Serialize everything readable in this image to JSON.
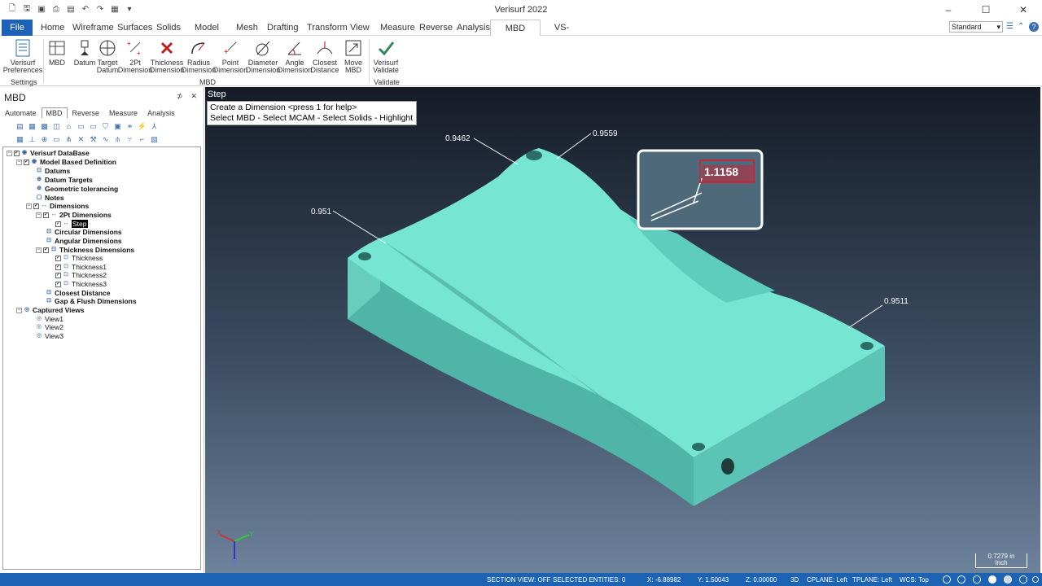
{
  "app": {
    "title": "Verisurf 2022"
  },
  "qat": {
    "more": "▾"
  },
  "tabs": [
    "File",
    "Home",
    "Wireframe",
    "Surfaces",
    "Solids",
    "Model Prep",
    "Mesh",
    "Drafting",
    "Transform",
    "View",
    "Measure",
    "Reverse",
    "Analysis",
    "MBD Validate",
    "VS-Tools"
  ],
  "active_tab": "MBD Validate",
  "style_select": "Standard",
  "ribbon": {
    "buttons": [
      {
        "l1": "Verisurf",
        "l2": "Preferences"
      },
      {
        "l1": "MBD",
        "l2": ""
      },
      {
        "l1": "Datum",
        "l2": ""
      },
      {
        "l1": "Target",
        "l2": "Datum"
      },
      {
        "l1": "2Pt",
        "l2": "Dimension"
      },
      {
        "l1": "Thickness",
        "l2": "Dimension"
      },
      {
        "l1": "Radius",
        "l2": "Dimension"
      },
      {
        "l1": "Point",
        "l2": "Dimension"
      },
      {
        "l1": "Diameter",
        "l2": "Dimension"
      },
      {
        "l1": "Angle",
        "l2": "Dimension"
      },
      {
        "l1": "Closest",
        "l2": "Distance"
      },
      {
        "l1": "Move",
        "l2": "MBD"
      },
      {
        "l1": "Verisurf",
        "l2": "Validate"
      }
    ],
    "groups": {
      "settings": "Settings",
      "mbd": "MBD",
      "validate": "Validate"
    }
  },
  "panel": {
    "title": "MBD",
    "pin": "⊅",
    "close": "✕",
    "tabs": [
      "Automate",
      "MBD",
      "Reverse",
      "Measure",
      "Analysis"
    ],
    "active_tab": "MBD",
    "tree": [
      "Verisurf DataBase",
      "Model Based Definition",
      "Datums",
      "Datum Targets",
      "Geometric tolerancing",
      "Notes",
      "Dimensions",
      "2Pt Dimensions",
      "Step",
      "Circular Dimensions",
      "Angular Dimensions",
      "Thickness Dimensions",
      "Thickness",
      "Thickness1",
      "Thickness2",
      "Thickness3",
      "Closest Distance",
      "Gap & Flush Dimensions",
      "Captured Views",
      "View1",
      "View2",
      "View3"
    ]
  },
  "viewport": {
    "title": "Step",
    "prompt_line1": "Create a Dimension <press 1 for help>",
    "prompt_line2": "Select MBD - Select MCAM - Select Solids - Highlight",
    "dims": [
      "0.9462",
      "0.9559",
      "0.951",
      "0.9511"
    ],
    "callout_value": "1.1158",
    "axis_x": "X",
    "axis_y": "Y",
    "axis_z": "Z",
    "scale_value": "0.7279 in",
    "scale_unit": "Inch"
  },
  "status": {
    "section_view": "SECTION VIEW: OFF",
    "selected": "SELECTED ENTITIES: 0",
    "x": "X:   -6.88982",
    "y": "Y:   1.50043",
    "z": "Z:   0.00000",
    "mode": "3D",
    "cplane": "CPLANE: Left",
    "tplane": "TPLANE: Left",
    "wcs": "WCS: Top"
  },
  "colors": {
    "file_tab": "#1e61b8",
    "statusbar": "#1d63b4",
    "part": "#6fe0cf"
  }
}
